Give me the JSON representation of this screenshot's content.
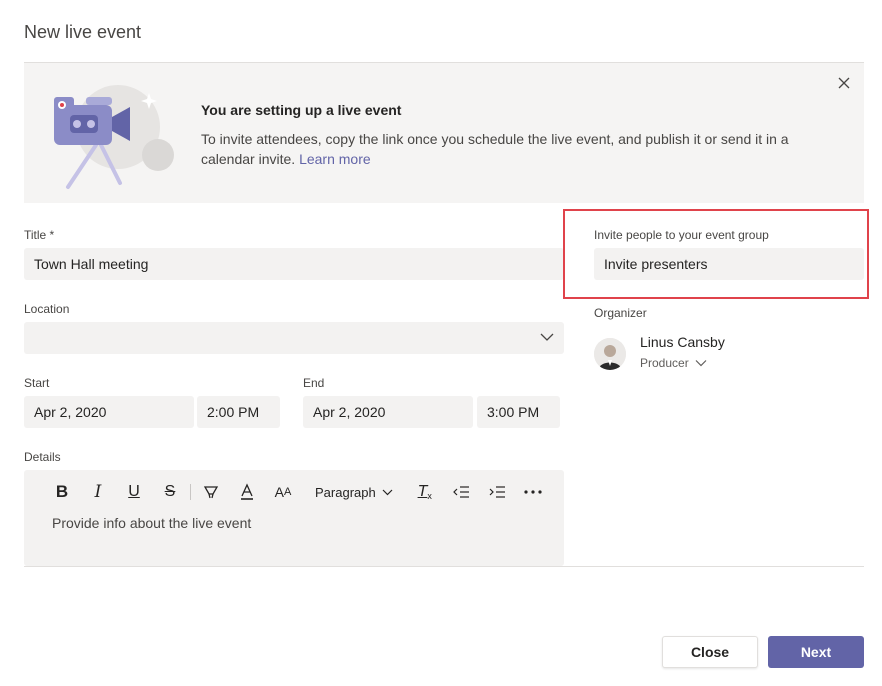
{
  "dialog": {
    "title": "New live event"
  },
  "banner": {
    "heading": "You are setting up a live event",
    "text": "To invite attendees, copy the link once you schedule the live event, and publish it or send it in a calendar invite.",
    "link": "Learn more"
  },
  "form": {
    "title_label": "Title *",
    "title_value": "Town Hall meeting",
    "location_label": "Location",
    "location_value": "",
    "start_label": "Start",
    "start_date": "Apr 2, 2020",
    "start_time": "2:00 PM",
    "end_label": "End",
    "end_date": "Apr 2, 2020",
    "end_time": "3:00 PM",
    "details_label": "Details",
    "details_placeholder": "Provide info about the live event",
    "paragraph_label": "Paragraph"
  },
  "invite": {
    "label": "Invite people to your event group",
    "placeholder": "Invite presenters"
  },
  "organizer": {
    "label": "Organizer",
    "name": "Linus Cansby",
    "role": "Producer"
  },
  "buttons": {
    "close": "Close",
    "next": "Next"
  },
  "colors": {
    "accent": "#6264a7",
    "highlight": "#e0434b",
    "field_bg": "#f3f2f1"
  }
}
